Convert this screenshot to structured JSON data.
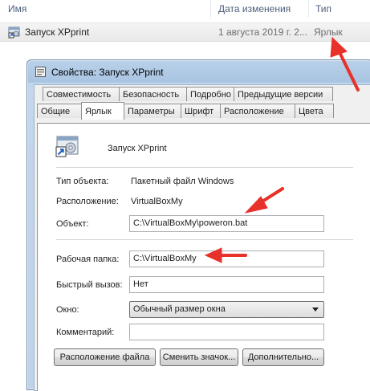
{
  "explorer": {
    "columns": {
      "name": "Имя",
      "date": "Дата изменения",
      "type": "Тип"
    },
    "file": {
      "name": "Запуск XPprint",
      "date": "1 августа 2019 г. 2...",
      "type": "Ярлык"
    }
  },
  "window": {
    "title": "Свойства: Запуск XPprint",
    "tabs_row1": [
      "Совместимость",
      "Безопасность",
      "Подробно",
      "Предыдущие версии"
    ],
    "tabs_row2": [
      "Общие",
      "Ярлык",
      "Параметры",
      "Шрифт",
      "Расположение",
      "Цвета"
    ],
    "active_tab": "Ярлык"
  },
  "shortcut": {
    "name": "Запуск XPprint",
    "type_label": "Тип объекта:",
    "type_value": "Пакетный файл Windows",
    "location_label": "Расположение:",
    "location_value": "VirtualBoxMy",
    "target_label": "Объект:",
    "target_value": "C:\\VirtualBoxMy\\poweron.bat",
    "workdir_label": "Рабочая папка:",
    "workdir_value": "C:\\VirtualBoxMy",
    "hotkey_label": "Быстрый вызов:",
    "hotkey_value": "Нет",
    "window_label": "Окно:",
    "window_value": "Обычный размер окна",
    "comment_label": "Комментарий:",
    "comment_value": ""
  },
  "buttons": {
    "open_location": "Расположение файла",
    "change_icon": "Сменить значок...",
    "advanced": "Дополнительно..."
  },
  "annotation_color": "#e8312a"
}
